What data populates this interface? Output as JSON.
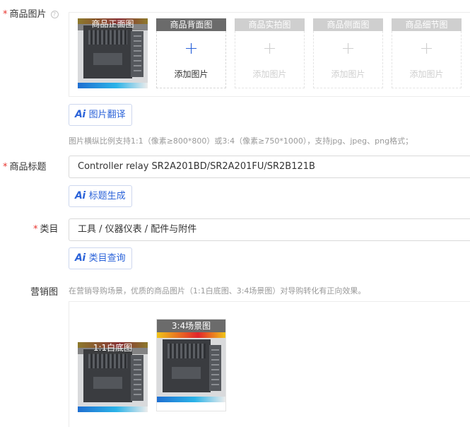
{
  "product_images": {
    "label": "商品图片",
    "required_mark": "*",
    "help_glyph": "?",
    "slots": [
      {
        "title": "商品正面图",
        "filled": true
      },
      {
        "title": "商品背面图",
        "add_text": "添加图片",
        "plus": "+",
        "state": "active"
      },
      {
        "title": "商品实拍图",
        "add_text": "添加图片",
        "plus": "+",
        "state": "disabled"
      },
      {
        "title": "商品侧面图",
        "add_text": "添加图片",
        "plus": "+",
        "state": "disabled"
      },
      {
        "title": "商品细节图",
        "add_text": "添加图片",
        "plus": "+",
        "state": "disabled"
      }
    ],
    "ai_button": {
      "icon": "Ai",
      "label": "图片翻译"
    },
    "hint": "图片横纵比例支持1:1（像素≥800*800）或3:4（像素≥750*1000），支持jpg、jpeg、png格式；"
  },
  "product_title": {
    "label": "商品标题",
    "required_mark": "*",
    "value": "Controller relay SR2A201BD/SR2A201FU/SR2B121B",
    "ai_button": {
      "icon": "Ai",
      "label": "标题生成"
    }
  },
  "category": {
    "label": "类目",
    "required_mark": "*",
    "value": "工具 / 仪器仪表 / 配件与附件",
    "ai_button": {
      "icon": "Ai",
      "label": "类目查询"
    }
  },
  "marketing_images": {
    "label": "营销图",
    "hint": "在营销导购场景，优质的商品图片（1:1白底图、3:4场景图）对导购转化有正向效果。",
    "items": [
      {
        "title": "1:1白底图"
      },
      {
        "title": "3:4场景图"
      }
    ]
  },
  "colors": {
    "accent": "#2b63d9",
    "required": "#e8342e",
    "slot_header": "#6b6b6b",
    "slot_header_disabled": "#cfcfcf"
  }
}
